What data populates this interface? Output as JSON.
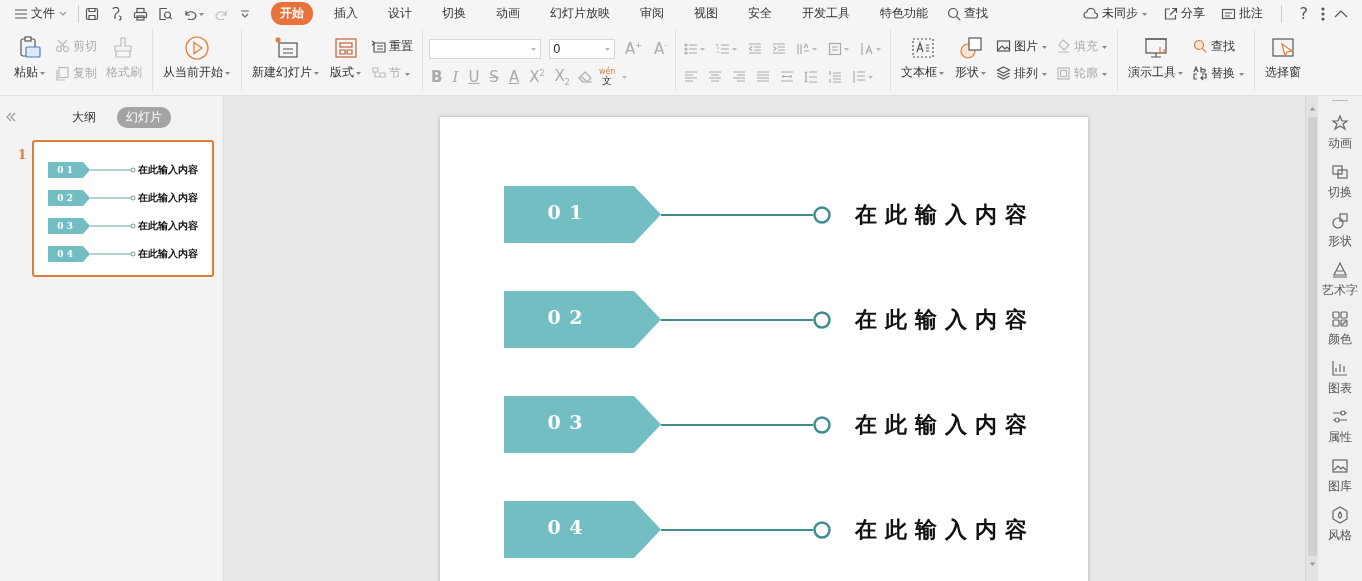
{
  "menu_bar": {
    "file_menu": "文件",
    "tabs": [
      {
        "label": "开始",
        "selected": true
      },
      {
        "label": "插入",
        "selected": false
      },
      {
        "label": "设计",
        "selected": false
      },
      {
        "label": "切换",
        "selected": false
      },
      {
        "label": "动画",
        "selected": false
      },
      {
        "label": "幻灯片放映",
        "selected": false
      },
      {
        "label": "审阅",
        "selected": false
      },
      {
        "label": "视图",
        "selected": false
      },
      {
        "label": "安全",
        "selected": false
      },
      {
        "label": "开发工具",
        "selected": false
      },
      {
        "label": "特色功能",
        "selected": false
      }
    ],
    "search": "查找",
    "sync": "未同步",
    "share": "分享",
    "comment": "批注",
    "help": "?"
  },
  "ribbon": {
    "groups": [
      {
        "items": [
          {
            "kind": "large",
            "label": "粘贴",
            "dropdown": true,
            "disabled": false
          },
          {
            "kind": "stack",
            "items": [
              {
                "label": "剪切",
                "dropdown": false,
                "disabled": true
              },
              {
                "label": "复制",
                "dropdown": false,
                "disabled": true
              }
            ]
          },
          {
            "kind": "large",
            "label": "格式刷",
            "dropdown": false,
            "disabled": true
          }
        ]
      },
      {
        "items": [
          {
            "kind": "large",
            "label": "从当前开始",
            "dropdown": true,
            "disabled": false
          }
        ]
      },
      {
        "items": [
          {
            "kind": "large",
            "label": "新建幻灯片",
            "dropdown": true,
            "disabled": false
          },
          {
            "kind": "large",
            "label": "版式",
            "dropdown": true,
            "disabled": false
          },
          {
            "kind": "stack",
            "items": [
              {
                "label": "重置",
                "dropdown": false,
                "disabled": false
              },
              {
                "label": "节",
                "dropdown": true,
                "disabled": true
              }
            ]
          }
        ]
      },
      {
        "items": [
          {
            "kind": "font",
            "font_size": "0",
            "size_buttons": [
              "A$^{+}$",
              "A$^{-}$"
            ],
            "format_buttons": [
              "B",
              "I",
              "U",
              "S",
              "A",
              "X$^{2}$",
              "X$_{2}$"
            ],
            "phonetic_top": "wén",
            "phonetic_bottom": "文"
          }
        ]
      },
      {
        "items": [
          {
            "kind": "paragraph",
            "rows": [
              [
                {
                  "dropdown": true
                },
                {
                  "dropdown": true
                },
                {
                  "dropdown": false
                },
                {
                  "dropdown": false
                },
                {
                  "dropdown": true
                },
                {
                  "dropdown": true
                },
                {
                  "dropdown": true
                }
              ],
              [
                {
                  "dropdown": false
                },
                {
                  "dropdown": false
                },
                {
                  "dropdown": false
                },
                {
                  "dropdown": false
                },
                {
                  "dropdown": false
                },
                {
                  "dropdown": false
                },
                {
                  "dropdown": false
                },
                {
                  "dropdown": true
                }
              ]
            ]
          }
        ]
      },
      {
        "items": [
          {
            "kind": "large",
            "label": "文本框",
            "dropdown": true,
            "disabled": false
          },
          {
            "kind": "large",
            "label": "形状",
            "dropdown": true,
            "disabled": false
          },
          {
            "kind": "stack",
            "items": [
              {
                "label": "图片",
                "dropdown": true,
                "disabled": false
              },
              {
                "label": "排列",
                "dropdown": true,
                "disabled": false
              }
            ]
          },
          {
            "kind": "stack",
            "items": [
              {
                "label": "填充",
                "dropdown": true,
                "disabled": true
              },
              {
                "label": "轮廓",
                "dropdown": true,
                "disabled": true
              }
            ]
          }
        ]
      },
      {
        "items": [
          {
            "kind": "large",
            "label": "演示工具",
            "dropdown": true,
            "disabled": false
          },
          {
            "kind": "stack",
            "items": [
              {
                "label": "查找",
                "dropdown": false,
                "disabled": false
              },
              {
                "label": "替换",
                "dropdown": true,
                "disabled": false
              }
            ]
          }
        ]
      },
      {
        "items": [
          {
            "kind": "large",
            "label": "选择窗",
            "dropdown": false,
            "disabled": false
          }
        ]
      }
    ]
  },
  "left_panel": {
    "tabs": [
      {
        "label": "大纲",
        "selected": false
      },
      {
        "label": "幻灯片",
        "selected": true
      }
    ],
    "slides": [
      {
        "number": "1",
        "selected": true,
        "items": [
          {
            "number": "0 1",
            "text": "在此输入内容"
          },
          {
            "number": "0 2",
            "text": "在此输入内容"
          },
          {
            "number": "0 3",
            "text": "在此输入内容"
          },
          {
            "number": "0 4",
            "text": "在此输入内容"
          }
        ]
      }
    ]
  },
  "slide": {
    "items": [
      {
        "number": "0 1",
        "text": "在此输入内容"
      },
      {
        "number": "0 2",
        "text": "在此输入内容"
      },
      {
        "number": "0 3",
        "text": "在此输入内容"
      },
      {
        "number": "0 4",
        "text": "在此输入内容"
      }
    ]
  },
  "right_sidebar": [
    {
      "label": "动画"
    },
    {
      "label": "切换"
    },
    {
      "label": "形状"
    },
    {
      "label": "艺术字"
    },
    {
      "label": "颜色"
    },
    {
      "label": "图表"
    },
    {
      "label": "属性"
    },
    {
      "label": "图库"
    },
    {
      "label": "风格"
    }
  ]
}
